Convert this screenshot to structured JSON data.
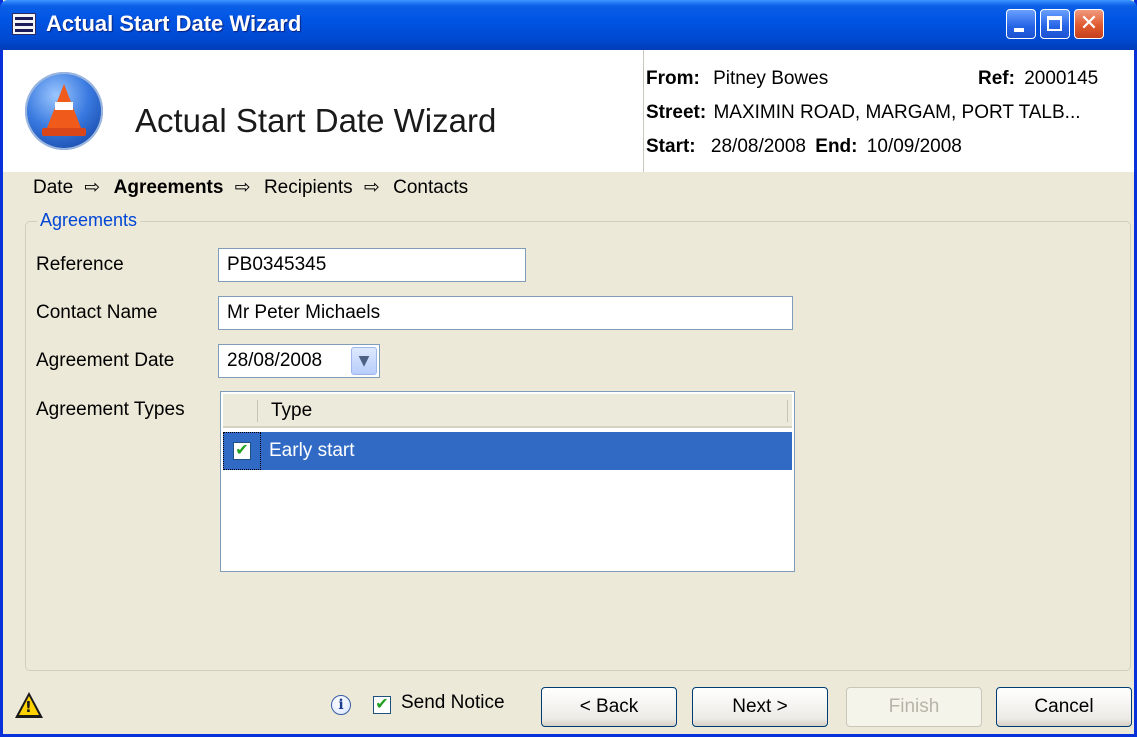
{
  "window": {
    "title": "Actual Start Date Wizard",
    "close_glyph": "✕"
  },
  "header": {
    "wizard_title": "Actual Start Date Wizard",
    "from_label": "From:",
    "from_value": "Pitney Bowes",
    "ref_label": "Ref:",
    "ref_value": "2000145",
    "street_label": "Street:",
    "street_value": "MAXIMIN ROAD, MARGAM, PORT TALB...",
    "start_label": "Start:",
    "start_value": "28/08/2008",
    "end_label": "End:",
    "end_value": "10/09/2008"
  },
  "breadcrumb": {
    "arrow": "⇨",
    "steps": [
      "Date",
      "Agreements",
      "Recipients",
      "Contacts"
    ],
    "active_index": 1
  },
  "agreements": {
    "group_title": "Agreements",
    "reference_label": "Reference",
    "reference_value": "PB0345345",
    "contact_name_label": "Contact Name",
    "contact_name_value": "Mr Peter Michaels",
    "agreement_date_label": "Agreement Date",
    "agreement_date_value": "28/08/2008",
    "agreement_types_label": "Agreement Types",
    "grid": {
      "column_header": "Type",
      "rows": [
        {
          "type": "Early start",
          "checked": true,
          "selected": true
        }
      ]
    }
  },
  "footer": {
    "info_glyph": "i",
    "warning_glyph": "!",
    "send_notice_label": "Send Notice",
    "send_notice_checked": true,
    "back_label": "< Back",
    "next_label": "Next >",
    "finish_label": "Finish",
    "finish_enabled": false,
    "cancel_label": "Cancel"
  },
  "colors": {
    "title_bar": "#0054e3",
    "selection": "#316ac5",
    "group_label": "#0046d5",
    "dialog_background": "#ece9d8"
  }
}
